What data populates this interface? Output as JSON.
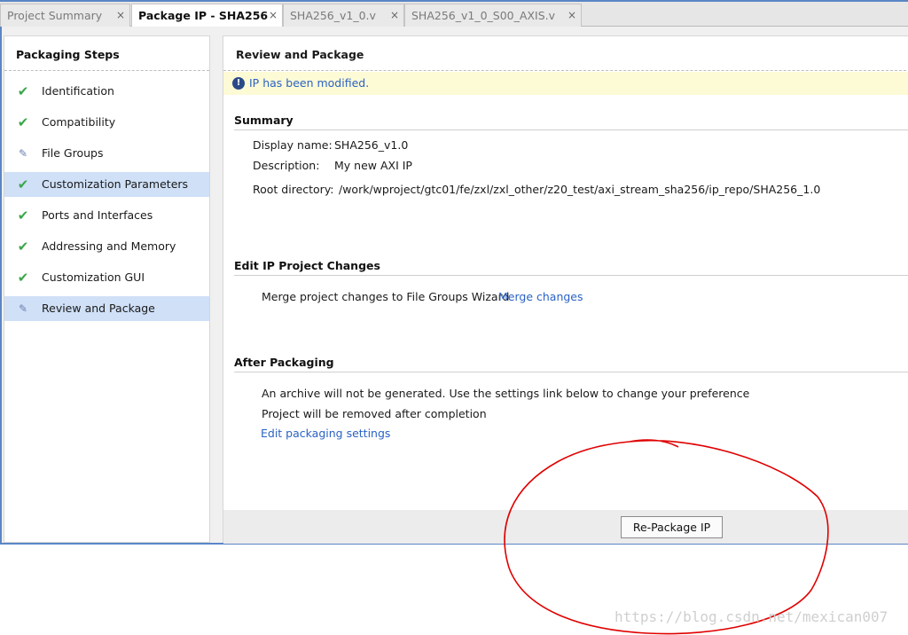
{
  "tabs": [
    {
      "label": "Project Summary",
      "close": "×"
    },
    {
      "label": "Package IP - SHA256",
      "close": "×"
    },
    {
      "label": "SHA256_v1_0.v",
      "close": "×"
    },
    {
      "label": "SHA256_v1_0_S00_AXIS.v",
      "close": "×"
    }
  ],
  "left_panel": {
    "title": "Packaging Steps",
    "steps": [
      {
        "label": "Identification",
        "icon": "check-icon"
      },
      {
        "label": "Compatibility",
        "icon": "check-icon"
      },
      {
        "label": "File Groups",
        "icon": "edit-icon"
      },
      {
        "label": "Customization Parameters",
        "icon": "check-icon"
      },
      {
        "label": "Ports and Interfaces",
        "icon": "check-icon"
      },
      {
        "label": "Addressing and Memory",
        "icon": "check-icon"
      },
      {
        "label": "Customization GUI",
        "icon": "check-icon"
      },
      {
        "label": "Review and Package",
        "icon": "edit-icon"
      }
    ]
  },
  "right_panel": {
    "title": "Review and Package",
    "banner": {
      "icon": "!",
      "message": "IP has been modified."
    },
    "summary": {
      "title": "Summary",
      "display_name_label": "Display name:",
      "display_name": "SHA256_v1.0",
      "description_label": "Description:",
      "description": "My new AXI IP",
      "root_label": "Root directory:",
      "root": "/work/wproject/gtc01/fe/zxl/zxl_other/z20_test/axi_stream_sha256/ip_repo/SHA256_1.0"
    },
    "edit_changes": {
      "title": "Edit IP Project Changes",
      "text": "Merge project changes to File Groups Wizard",
      "link": "Merge changes"
    },
    "after_packaging": {
      "title": "After Packaging",
      "line1": "An archive will not be generated. Use the settings link below to change your preference",
      "line2": "Project will be removed after completion",
      "link": "Edit packaging settings"
    },
    "button": "Re-Package IP"
  },
  "watermark": "https://blog.csdn.net/mexican007",
  "colors": {
    "accent": "#5b86c6",
    "selected": "#cfe0f7",
    "link": "#2a62c4",
    "check": "#3aa64a",
    "banner": "#fdfad6",
    "annotation": "#e00000"
  }
}
